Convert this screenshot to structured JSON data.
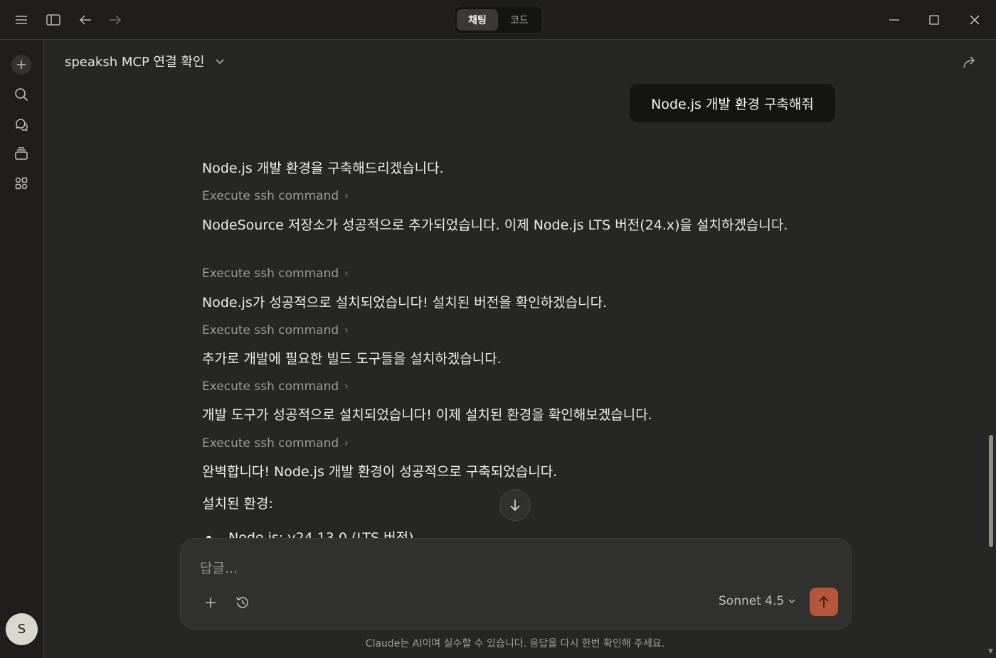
{
  "titlebar": {
    "toggle": {
      "active": "채팅",
      "inactive": "코드"
    }
  },
  "header": {
    "chat_title": "speaksh MCP 연결 확인"
  },
  "conversation": {
    "user_message": "Node.js 개발 환경 구축해줘",
    "assistant": [
      {
        "type": "text",
        "text": "Node.js 개발 환경을 구축해드리겠습니다."
      },
      {
        "type": "tool",
        "text": "Execute ssh command"
      },
      {
        "type": "text",
        "text": "NodeSource 저장소가 성공적으로 추가되었습니다. 이제 Node.js LTS 버전(24.x)을 설치하겠습니다."
      },
      {
        "type": "tool",
        "text": "Execute ssh command"
      },
      {
        "type": "text",
        "text": "Node.js가 성공적으로 설치되었습니다! 설치된 버전을 확인하겠습니다."
      },
      {
        "type": "tool",
        "text": "Execute ssh command"
      },
      {
        "type": "text",
        "text": "추가로 개발에 필요한 빌드 도구들을 설치하겠습니다."
      },
      {
        "type": "tool",
        "text": "Execute ssh command"
      },
      {
        "type": "text",
        "text": "개발 도구가 성공적으로 설치되었습니다! 이제 설치된 환경을 확인해보겠습니다."
      },
      {
        "type": "tool",
        "text": "Execute ssh command"
      },
      {
        "type": "text",
        "text": "완벽합니다! Node.js 개발 환경이 성공적으로 구축되었습니다."
      },
      {
        "type": "text",
        "text": "설치된 환경:"
      }
    ],
    "partial_bullet": "Node.js: v24.13.0 (LTS 버전)"
  },
  "composer": {
    "placeholder": "답글...",
    "model": "Sonnet 4.5"
  },
  "footer": {
    "disclaimer": "Claude는 AI이며 실수할 수 있습니다. 응답을 다시 한번 확인해 주세요."
  },
  "user": {
    "avatar_initial": "S"
  },
  "colors": {
    "accent": "#b5553a",
    "background": "#262624",
    "sidebar": "#1f1e1d"
  }
}
